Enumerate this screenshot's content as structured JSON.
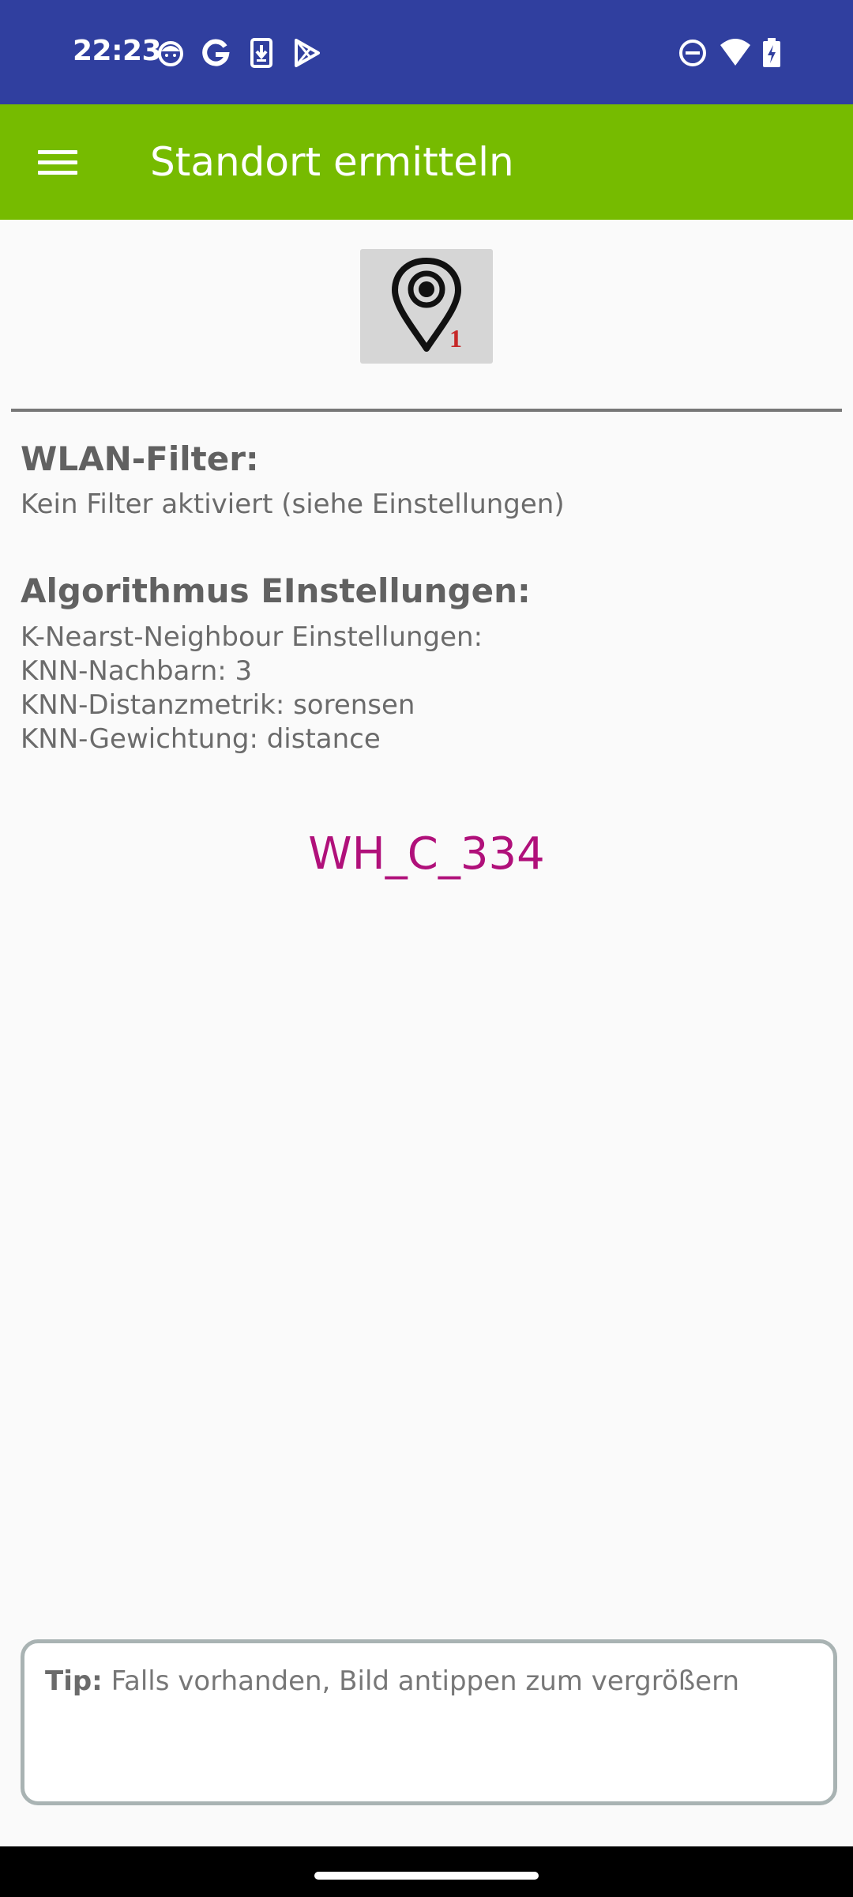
{
  "status_bar": {
    "time": "22:23",
    "left_icons": [
      "face-notification-icon",
      "google-icon",
      "download-icon",
      "play-store-icon"
    ],
    "right_icons": [
      "do-not-disturb-icon",
      "wifi-icon",
      "battery-charging-icon"
    ]
  },
  "app_bar": {
    "menu_icon": "hamburger-menu-icon",
    "title": "Standort ermitteln",
    "color": "#76bb00"
  },
  "locate_button": {
    "icon": "map-pin-icon",
    "badge": "1"
  },
  "wlan_filter": {
    "title": "WLAN-Filter:",
    "value": "Kein Filter aktiviert (siehe Einstellungen)"
  },
  "algorithm": {
    "title": "Algorithmus EInstellungen:",
    "lines": [
      "K-Nearst-Neighbour Einstellungen:",
      "KNN-Nachbarn: 3",
      "KNN-Distanzmetrik: sorensen",
      "KNN-Gewichtung: distance"
    ]
  },
  "result": {
    "location": "WH_C_334",
    "color": "#b0107a"
  },
  "tip": {
    "label": "Tip:",
    "text": " Falls vorhanden, Bild antippen zum vergrößern"
  }
}
